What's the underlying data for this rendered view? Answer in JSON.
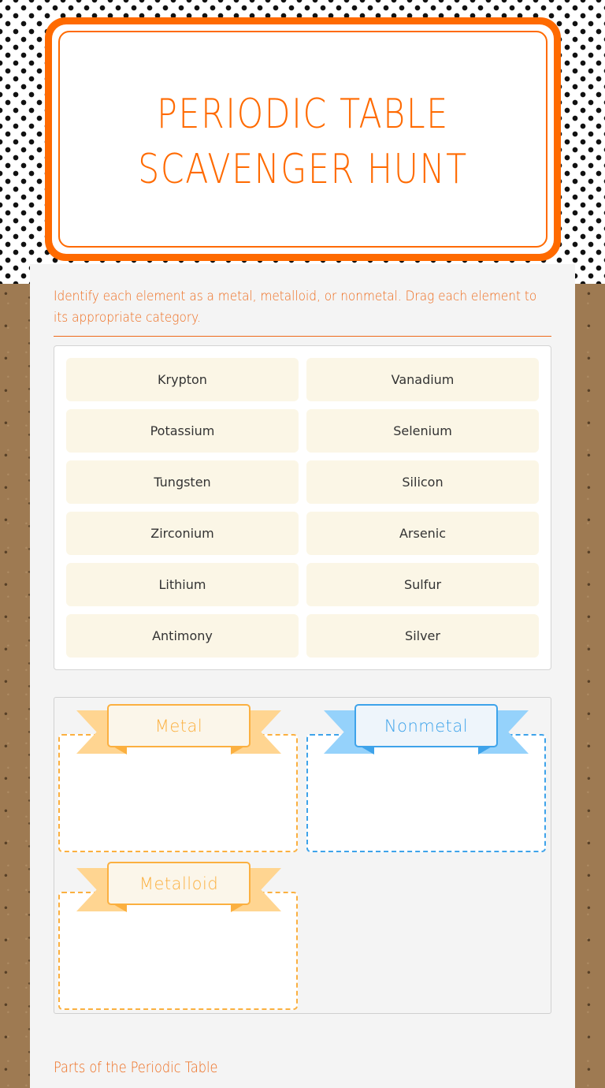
{
  "header": {
    "title_line1": "PERIODIC TABLE",
    "title_line2": "SCAVENGER HUNT"
  },
  "instructions": "Identify each element as a metal, metalloid, or nonmetal. Drag each element to its appropriate category.",
  "elements": [
    "Krypton",
    "Vanadium",
    "Potassium",
    "Selenium",
    "Tungsten",
    "Silicon",
    "Zirconium",
    "Arsenic",
    "Lithium",
    "Sulfur",
    "Antimony",
    "Silver"
  ],
  "categories": [
    {
      "label": "Metal",
      "color": "#fbb040"
    },
    {
      "label": "Nonmetal",
      "color": "#3ea3ea"
    },
    {
      "label": "Metalloid",
      "color": "#fbb040"
    }
  ],
  "next_section_heading": "Parts of the Periodic Table",
  "colors": {
    "accent_orange": "#ff6a00",
    "chip_background": "#fbf6e6",
    "panel_background": "#f4f4f4"
  }
}
